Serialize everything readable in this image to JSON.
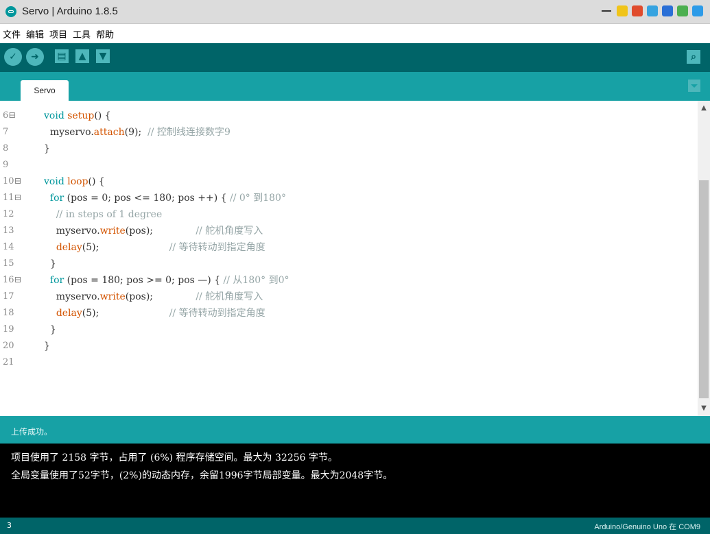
{
  "window": {
    "title": "Servo | Arduino 1.8.5"
  },
  "menu": [
    "文件",
    "编辑",
    "项目",
    "工具",
    "帮助"
  ],
  "toolbar": {
    "verify_glyph": "✓",
    "upload_glyph": "➜",
    "new_glyph": "▤",
    "open_glyph": "▲",
    "save_glyph": "▼",
    "serial_glyph": "⌕"
  },
  "tabs": [
    {
      "label": "Servo"
    }
  ],
  "editor": {
    "lines": [
      {
        "num": "6⊟",
        "code": "void setup() {"
      },
      {
        "num": "7",
        "code": "  myservo.attach(9);  // 控制线连接数字9"
      },
      {
        "num": "8",
        "code": "}"
      },
      {
        "num": "9",
        "code": ""
      },
      {
        "num": "10⊟",
        "code": "void loop() {"
      },
      {
        "num": "11⊟",
        "code": "  for (pos = 0; pos <= 180; pos ++) { // 0° 到180°"
      },
      {
        "num": "12",
        "code": "    // in steps of 1 degree"
      },
      {
        "num": "13",
        "code": "    myservo.write(pos);              // 舵机角度写入"
      },
      {
        "num": "14",
        "code": "    delay(5);                       // 等待转动到指定角度"
      },
      {
        "num": "15",
        "code": "  }"
      },
      {
        "num": "16⊟",
        "code": "  for (pos = 180; pos >= 0; pos —) { // 从180° 到0°"
      },
      {
        "num": "17",
        "code": "    myservo.write(pos);              // 舵机角度写入"
      },
      {
        "num": "18",
        "code": "    delay(5);                       // 等待转动到指定角度"
      },
      {
        "num": "19",
        "code": "  }"
      },
      {
        "num": "20",
        "code": "}"
      },
      {
        "num": "21",
        "code": ""
      }
    ]
  },
  "status": {
    "message": "上传成功。"
  },
  "console": {
    "lines": [
      "项目使用了 2158 字节，占用了 (6%) 程序存储空间。最大为 32256 字节。",
      "全局变量使用了52字节，(2%)的动态内存，余留1996字节局部变量。最大为2048字节。"
    ]
  },
  "footer": {
    "line_number": "3",
    "board": "Arduino/Genuino Uno 在 COM9"
  },
  "colors": {
    "toolbar": "#006468",
    "tabbar": "#17a1a5",
    "button": "#4db7bb",
    "keyword": "#00979c",
    "function": "#d35400",
    "comment": "#95a5a6"
  }
}
